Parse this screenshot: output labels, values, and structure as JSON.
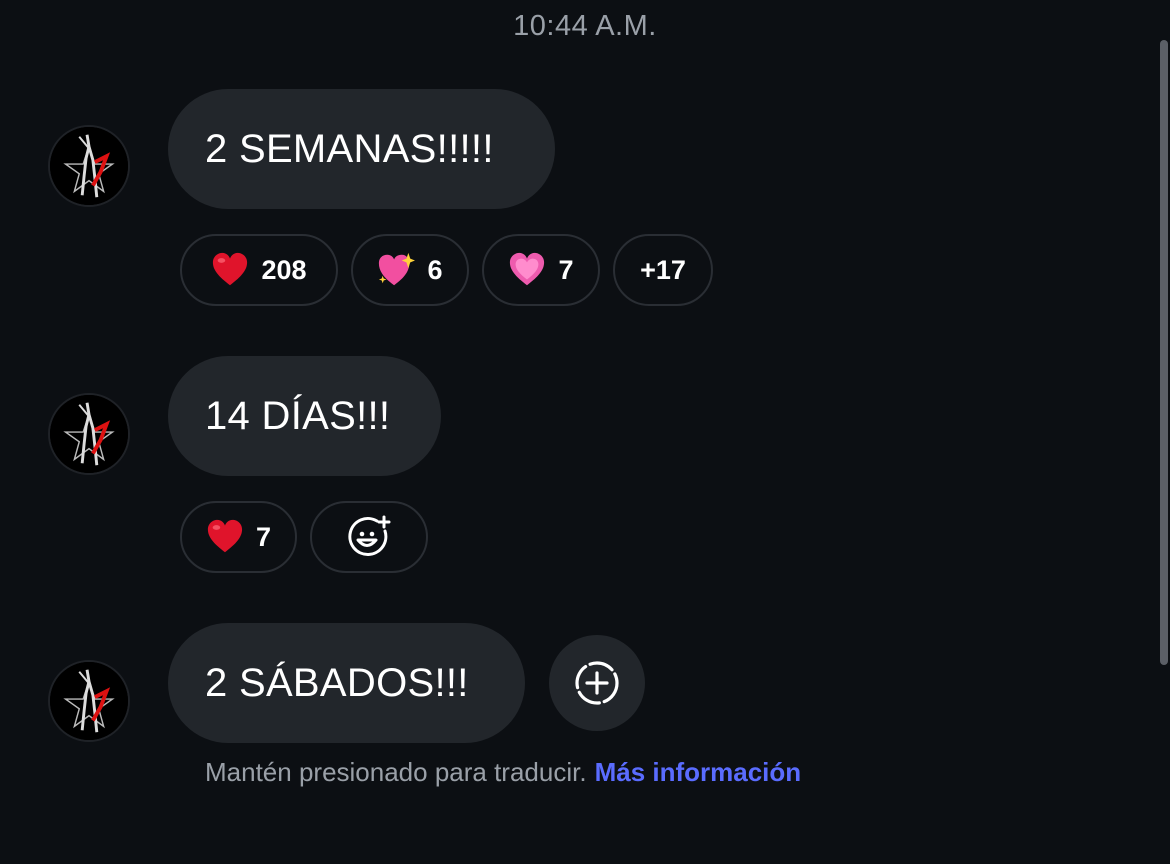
{
  "timestamp": "10:44 A.M.",
  "messages": [
    {
      "text": "2 SEMANAS!!!!!",
      "reactions": [
        {
          "emoji": "red-heart-icon",
          "count": "208"
        },
        {
          "emoji": "sparkling-heart-icon",
          "count": "6"
        },
        {
          "emoji": "pink-heart-icon",
          "count": "7"
        }
      ],
      "more": "+17"
    },
    {
      "text": "14 DÍAS!!!",
      "reactions": [
        {
          "emoji": "red-heart-icon",
          "count": "7"
        }
      ]
    },
    {
      "text": "2 SÁBADOS!!!"
    }
  ],
  "hint": {
    "text": "Mantén presionado para traducir.",
    "link": "Más información"
  },
  "colors": {
    "background": "#0c0f13",
    "bubble": "#22262b",
    "link": "#5a6cff",
    "muted": "#9aa0a8"
  }
}
